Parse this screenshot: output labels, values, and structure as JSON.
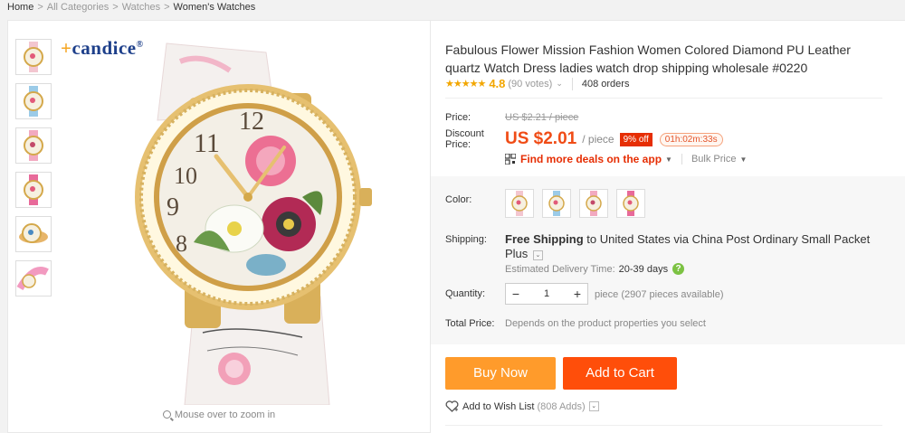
{
  "breadcrumb": {
    "items": [
      "Home",
      "All Categories",
      "Watches",
      "Women's Watches"
    ],
    "separator": ">"
  },
  "gallery": {
    "brand_logo": "candice",
    "zoom_hint": "Mouse over to zoom in",
    "thumbnail_count": 6
  },
  "product": {
    "title": "Fabulous Flower Mission Fashion Women Colored Diamond PU Leather quartz Watch Dress ladies watch drop shipping wholesale #0220",
    "rating": "4.8",
    "votes": "(90 votes)",
    "orders": "408 orders"
  },
  "price": {
    "price_label": "Price:",
    "old_price": "US $2.21 / piece",
    "discount_label": "Discount Price:",
    "new_price": "US $2.01",
    "per_unit": "/ piece",
    "discount_badge": "9% off",
    "countdown": "01h:02m:33s",
    "deals_text": "Find more deals on the app",
    "bulk_price": "Bulk Price"
  },
  "options": {
    "color_label": "Color:",
    "color_count": 4,
    "shipping_label": "Shipping:",
    "shipping_free": "Free Shipping",
    "shipping_to": "to",
    "shipping_dest": "United States via China Post Ordinary Small Packet Plus",
    "est_label": "Estimated Delivery Time:",
    "est_days": "20-39 days",
    "quantity_label": "Quantity:",
    "quantity_value": "1",
    "quantity_note": "piece (2907 pieces available)",
    "total_label": "Total Price:",
    "total_note": "Depends on the product properties you select"
  },
  "actions": {
    "buy_now": "Buy Now",
    "add_to_cart": "Add to Cart",
    "wishlist": "Add to Wish List",
    "wishlist_count": "(808 Adds)"
  },
  "colors": {
    "accent_price": "#f04c16",
    "buy_now": "#ff9b2b",
    "add_to_cart": "#ff4e0a",
    "stars": "#f2a600",
    "link_red": "#e62e04"
  }
}
